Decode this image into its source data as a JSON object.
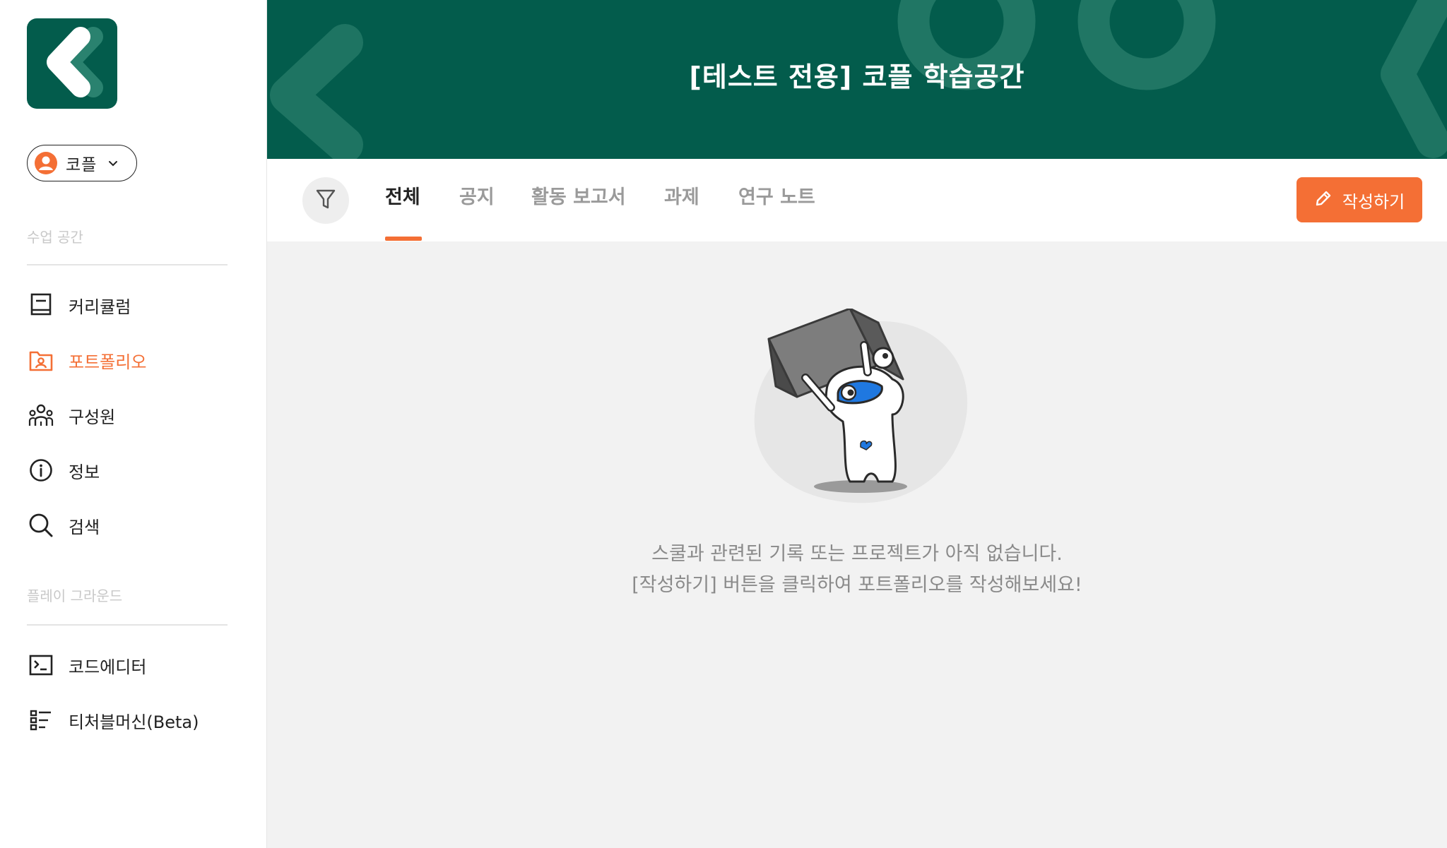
{
  "app": {
    "title": "[테스트 전용] 코플 학습공간",
    "colors": {
      "brand": "#035c4c",
      "accent": "#f46f35"
    }
  },
  "user": {
    "name": "코플",
    "icon": "user-avatar-icon"
  },
  "sidebar": {
    "section1": {
      "label": "수업 공간",
      "items": [
        {
          "label": "커리큘럼",
          "icon": "book-icon",
          "active": false
        },
        {
          "label": "포트폴리오",
          "icon": "portfolio-icon",
          "active": true
        },
        {
          "label": "구성원",
          "icon": "members-icon",
          "active": false
        },
        {
          "label": "정보",
          "icon": "info-icon",
          "active": false
        },
        {
          "label": "검색",
          "icon": "search-icon",
          "active": false
        }
      ]
    },
    "section2": {
      "label": "플레이 그라운드",
      "items": [
        {
          "label": "코드에디터",
          "icon": "terminal-icon",
          "active": false
        },
        {
          "label": "티처블머신(Beta)",
          "icon": "list-icon",
          "active": false
        }
      ]
    }
  },
  "tabs": [
    {
      "label": "전체",
      "active": true
    },
    {
      "label": "공지",
      "active": false
    },
    {
      "label": "활동 보고서",
      "active": false
    },
    {
      "label": "과제",
      "active": false
    },
    {
      "label": "연구 노트",
      "active": false
    }
  ],
  "toolbar": {
    "write_label": "작성하기",
    "write_icon": "pencil-icon",
    "filter_icon": "filter-icon"
  },
  "empty_state": {
    "line1": "스쿨과 관련된 기록 또는 프로젝트가 아직 없습니다.",
    "line2": "[작성하기] 버튼을 클릭하여 포트폴리오를 작성해보세요!"
  }
}
